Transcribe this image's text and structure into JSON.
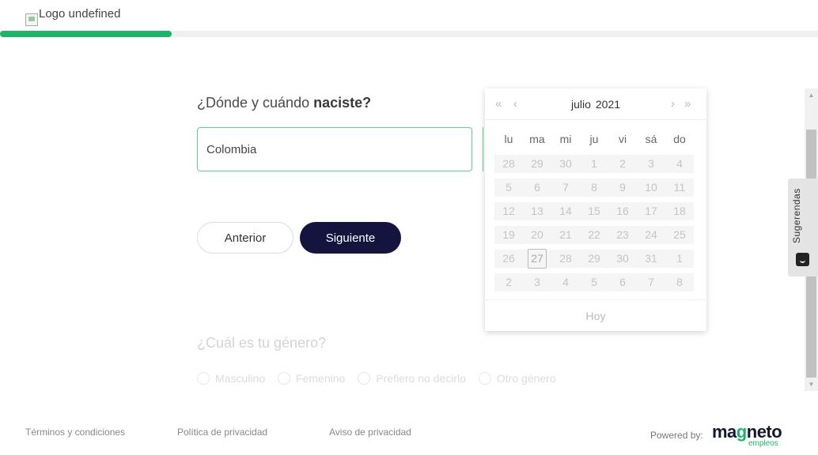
{
  "header": {
    "logo_alt": "Logo undefined",
    "progress_percent": 21
  },
  "form": {
    "birth_question_prefix": "¿Dónde y cuándo ",
    "birth_question_bold": "naciste?",
    "country_value": "Colombia",
    "prev_label": "Anterior",
    "next_label": "Siguiente",
    "gender_question": "¿Cuál es tu género?",
    "gender_options": [
      "Masculino",
      "Femenino",
      "Prefiero no decirlo",
      "Otro género"
    ]
  },
  "calendar": {
    "month": "julio",
    "year": "2021",
    "prev_year_icon": "«",
    "prev_month_icon": "‹",
    "next_month_icon": "›",
    "next_year_icon": "»",
    "weekdays": [
      "lu",
      "ma",
      "mi",
      "ju",
      "vi",
      "sá",
      "do"
    ],
    "weeks": [
      [
        "28",
        "29",
        "30",
        "1",
        "2",
        "3",
        "4"
      ],
      [
        "5",
        "6",
        "7",
        "8",
        "9",
        "10",
        "11"
      ],
      [
        "12",
        "13",
        "14",
        "15",
        "16",
        "17",
        "18"
      ],
      [
        "19",
        "20",
        "21",
        "22",
        "23",
        "24",
        "25"
      ],
      [
        "26",
        "27",
        "28",
        "29",
        "30",
        "31",
        "1"
      ],
      [
        "2",
        "3",
        "4",
        "5",
        "6",
        "7",
        "8"
      ]
    ],
    "today": "27",
    "today_label": "Hoy"
  },
  "sidebar": {
    "suggestions_label": "Sugerendas"
  },
  "footer": {
    "terms": "Términos y condiciones",
    "privacy_policy": "Política de privacidad",
    "privacy_notice": "Aviso de privacidad",
    "powered_by": "Powered by:",
    "brand_name": "magneto",
    "brand_sub": "empleos"
  },
  "colors": {
    "accent_green": "#1db46a",
    "primary_dark": "#15143f"
  }
}
